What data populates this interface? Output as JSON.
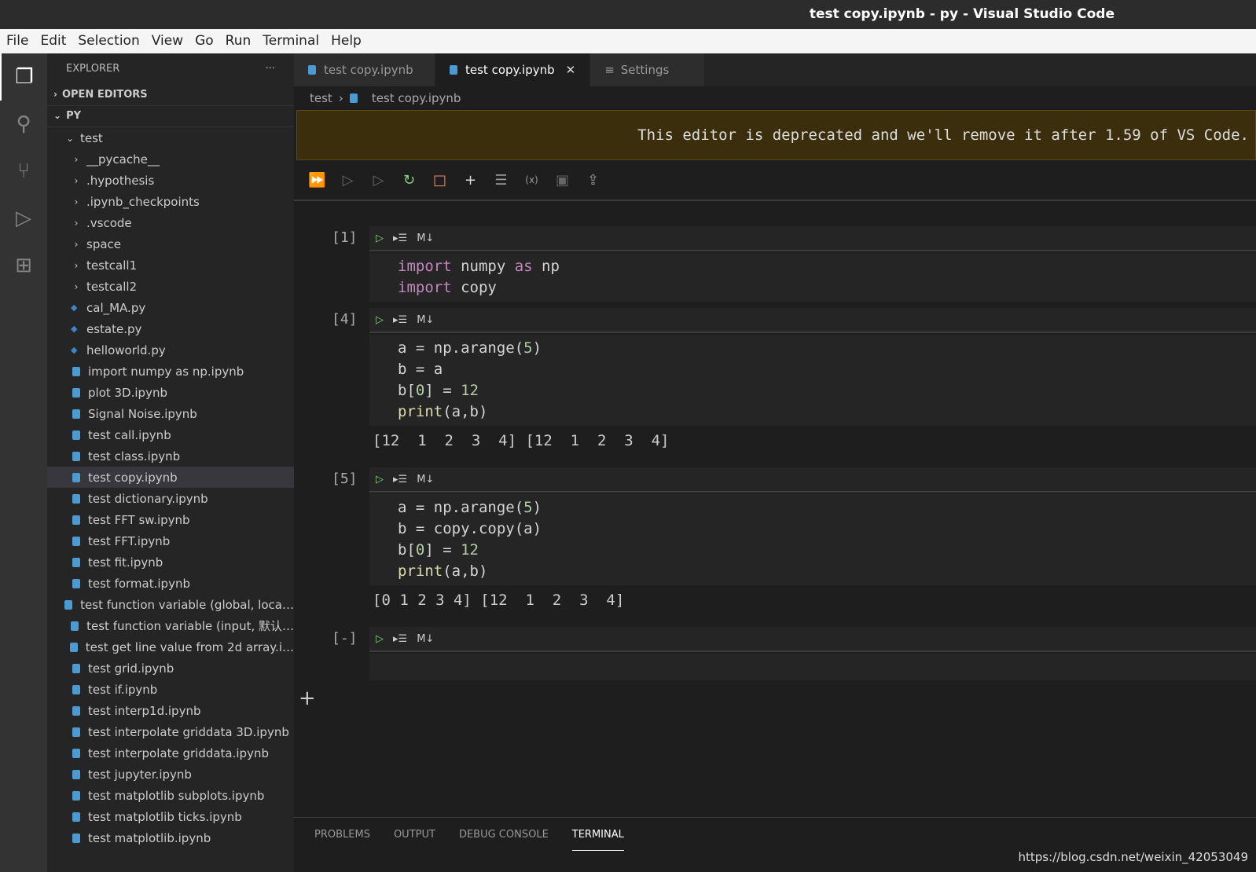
{
  "window": {
    "title": "test copy.ipynb - py - Visual Studio Code"
  },
  "menu": [
    "File",
    "Edit",
    "Selection",
    "View",
    "Go",
    "Run",
    "Terminal",
    "Help"
  ],
  "sidebar": {
    "title": "EXPLORER",
    "more": "···",
    "open_editors": "OPEN EDITORS",
    "root": "PY",
    "folder": "test",
    "folders": [
      "__pycache__",
      ".hypothesis",
      ".ipynb_checkpoints",
      ".vscode",
      "space",
      "testcall1",
      "testcall2"
    ],
    "py_files": [
      "cal_MA.py",
      "estate.py",
      "helloworld.py"
    ],
    "nb_files": [
      "import numpy as np.ipynb",
      "plot 3D.ipynb",
      "Signal Noise.ipynb",
      "test call.ipynb",
      "test class.ipynb",
      "test copy.ipynb",
      "test dictionary.ipynb",
      "test FFT sw.ipynb",
      "test FFT.ipynb",
      "test fit.ipynb",
      "test format.ipynb",
      "test function variable (global, loca…",
      "test function variable (input, 默认…",
      "test get line value from 2d array.i…",
      "test grid.ipynb",
      "test if.ipynb",
      "test interp1d.ipynb",
      "test interpolate griddata 3D.ipynb",
      "test interpolate griddata.ipynb",
      "test jupyter.ipynb",
      "test matplotlib subplots.ipynb",
      "test matplotlib ticks.ipynb",
      "test matplotlib.ipynb"
    ],
    "selected": "test copy.ipynb"
  },
  "tabs": [
    {
      "label": "test copy.ipynb"
    },
    {
      "label": "test copy.ipynb",
      "close": "✕"
    },
    {
      "label": "Settings"
    }
  ],
  "breadcrumb": [
    "test",
    "test copy.ipynb"
  ],
  "banner": "This editor is deprecated and we'll remove it after 1.59 of VS Code.",
  "cells": [
    {
      "num": "[1]",
      "md": "M↓"
    },
    {
      "num": "[4]",
      "md": "M↓",
      "output": "[12  1  2  3  4] [12  1  2  3  4]"
    },
    {
      "num": "[5]",
      "md": "M↓",
      "output": "[0 1 2 3 4] [12  1  2  3  4]"
    },
    {
      "num": "[-]",
      "md": "M↓"
    }
  ],
  "code": {
    "c1l1a": "import",
    "c1l1b": " numpy ",
    "c1l1c": "as",
    "c1l1d": " np",
    "c1l2a": "import",
    "c1l2b": " copy",
    "c2l1a": "a = np.arange(",
    "c2l1b": "5",
    "c2l1c": ")",
    "c2l2": "b = a",
    "c2l3a": "b[",
    "c2l3b": "0",
    "c2l3c": "] = ",
    "c2l3d": "12",
    "c2l4a": "print",
    "c2l4b": "(a,b)",
    "c3l1a": "a = np.arange(",
    "c3l1b": "5",
    "c3l1c": ")",
    "c3l2": "b = copy.copy(a)",
    "c3l3a": "b[",
    "c3l3b": "0",
    "c3l3c": "] = ",
    "c3l3d": "12",
    "c3l4a": "print",
    "c3l4b": "(a,b)"
  },
  "panel": {
    "tabs": [
      "PROBLEMS",
      "OUTPUT",
      "DEBUG CONSOLE",
      "TERMINAL"
    ],
    "active": "TERMINAL"
  },
  "watermark": "https://blog.csdn.net/weixin_42053049"
}
